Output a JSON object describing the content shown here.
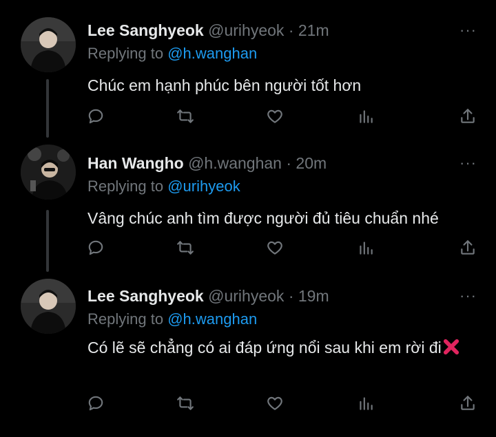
{
  "tweets": [
    {
      "name": "Lee Sanghyeok",
      "handle": "@urihyeok",
      "time": "· 21m",
      "replying_prefix": "Replying to",
      "replying_to": "@h.wanghan",
      "text": "Chúc em hạnh phúc bên người tốt hơn",
      "more": "···"
    },
    {
      "name": "Han Wangho",
      "handle": "@h.wanghan",
      "time": "· 20m",
      "replying_prefix": "Replying to",
      "replying_to": "@urihyeok",
      "text": "Vâng chúc anh tìm được người đủ tiêu chuẩn nhé",
      "more": "···"
    },
    {
      "name": "Lee Sanghyeok",
      "handle": "@urihyeok",
      "time": "· 19m",
      "replying_prefix": "Replying to",
      "replying_to": "@h.wanghan",
      "text": "Có lẽ sẽ chẳng có ai đáp ứng nổi sau khi em rời đi",
      "more": "···"
    }
  ],
  "icons": [
    "reply-icon",
    "retweet-icon",
    "like-icon",
    "analytics-icon",
    "share-icon",
    "more-icon",
    "cross-mark-emoji"
  ],
  "colors": {
    "background": "#000000",
    "text": "#e7e9ea",
    "muted": "#71767b",
    "link": "#1d9bf0",
    "cross": "#e0245e"
  }
}
